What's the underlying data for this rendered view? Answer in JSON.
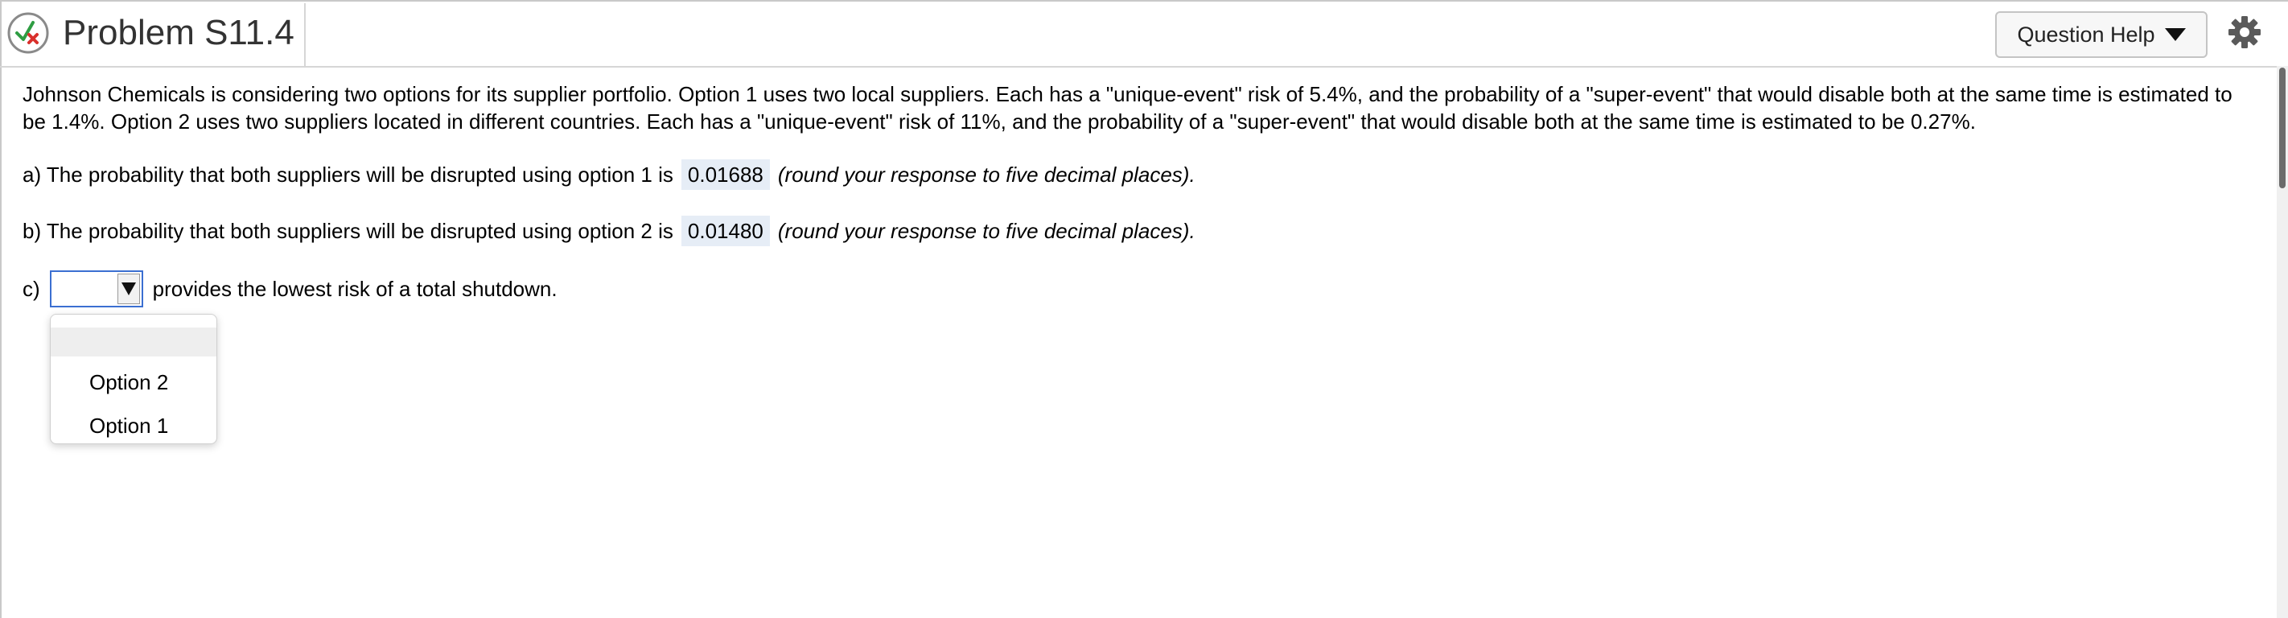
{
  "header": {
    "title": "Problem S11.4",
    "help_label": "Question Help"
  },
  "problem": {
    "text": "Johnson Chemicals is considering two options for its supplier portfolio. Option 1 uses two local suppliers. Each has a \"unique-event\" risk of 5.4%, and the probability of a \"super-event\" that would disable both at the same time is estimated to be 1.4%. Option 2 uses two suppliers located in different countries. Each has a \"unique-event\" risk of 11%, and the probability of a \"super-event\" that would disable both at the same time is estimated to be 0.27%."
  },
  "questions": {
    "a": {
      "prefix": "a) The probability that both suppliers will be disrupted using option 1 is",
      "answer": "0.01688",
      "hint": "(round your response to five decimal places)."
    },
    "b": {
      "prefix": "b) The probability that both suppliers will be disrupted using option 2 is",
      "answer": "0.01480",
      "hint": "(round your response to five decimal places)."
    },
    "c": {
      "prefix": "c)",
      "selected": "",
      "suffix": "provides the lowest risk of a total shutdown."
    }
  },
  "dropdown": {
    "options": [
      "",
      "Option 2",
      "Option 1"
    ]
  },
  "colors": {
    "answer_bg": "#e6edf6",
    "select_border": "#3b6fd1"
  },
  "icons": {
    "status": "partially-correct-icon",
    "help_caret": "caret-down-icon",
    "settings": "gear-icon",
    "select_arrow": "caret-down-icon"
  }
}
